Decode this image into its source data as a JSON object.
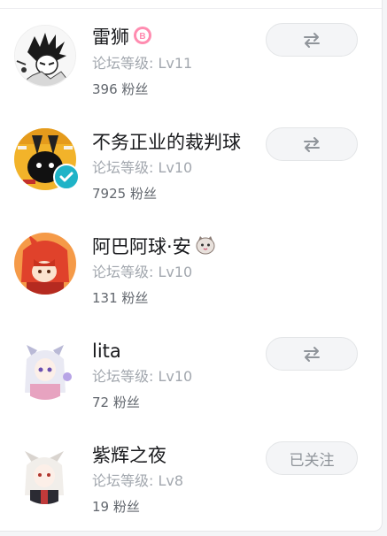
{
  "users": [
    {
      "name": "雷狮",
      "level": "论坛等级: Lv11",
      "fans": "396 粉丝",
      "button": "swap",
      "has_badge": true,
      "badge_letter": "B"
    },
    {
      "name": "不务正业的裁判球",
      "level": "论坛等级: Lv10",
      "fans": "7925 粉丝",
      "button": "swap",
      "verified": true
    },
    {
      "name": "阿巴阿球·安",
      "level": "论坛等级: Lv10",
      "fans": "131 粉丝",
      "button": "none",
      "has_emoji": true
    },
    {
      "name": "lita",
      "level": "论坛等级: Lv10",
      "fans": "72 粉丝",
      "button": "swap"
    },
    {
      "name": "紫辉之夜",
      "level": "论坛等级: Lv8",
      "fans": "19 粉丝",
      "button": "text",
      "button_label": "已关注"
    }
  ],
  "icons": {
    "swap": "swap-arrows-icon",
    "verified": "verified-check-icon",
    "badge": "pink-b-badge-icon"
  },
  "colors": {
    "name": "#18191c",
    "level": "#a2a7ae",
    "fans": "#61666d",
    "button_bg": "#f4f5f7",
    "verified": "#1fb3c7",
    "badge": "#ff8cb0"
  }
}
